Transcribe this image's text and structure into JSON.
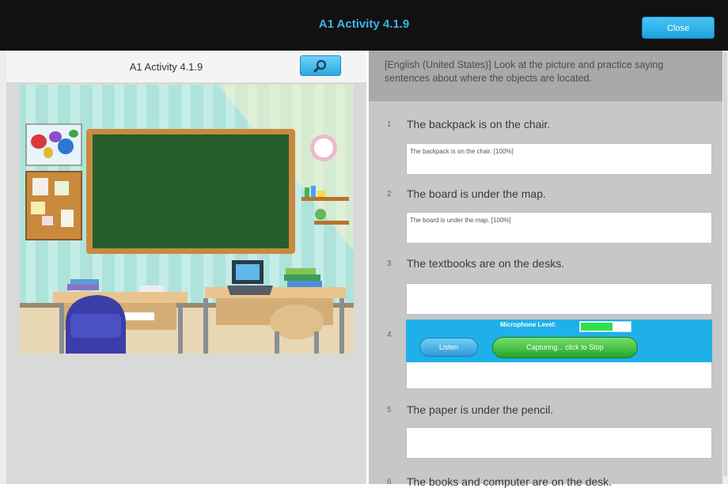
{
  "window": {
    "title": "A1 Activity 4.1.9",
    "close_label": "Close"
  },
  "left_panel": {
    "title": "A1 Activity 4.1.9",
    "zoom_icon": "magnifier-icon",
    "scene_description": "classroom-scene"
  },
  "instructions": "[English (United States)] Look at the picture and practice saying sentences about where the objects are located.",
  "items": [
    {
      "number": "1",
      "sentence": "The backpack is on the chair.",
      "response": "The backpack is on the chair. [100%]"
    },
    {
      "number": "2",
      "sentence": "The board is under the map.",
      "response": "The board is under the map. [100%]"
    },
    {
      "number": "3",
      "sentence": "The textbooks are on the desks.",
      "response": ""
    },
    {
      "number": "4",
      "sentence": "",
      "response": ""
    },
    {
      "number": "5",
      "sentence": "The paper is under the pencil.",
      "response": ""
    },
    {
      "number": "6",
      "sentence": "The books and computer are on the desk."
    }
  ],
  "recorder": {
    "mic_label": "Microphone Level:",
    "mic_level": 0.65,
    "listen_label": "Listen",
    "capture_label": "Capturing... click to Stop"
  },
  "colors": {
    "topbar": "#111111",
    "accent": "#1fb0ea",
    "capture_green": "#2db537"
  }
}
